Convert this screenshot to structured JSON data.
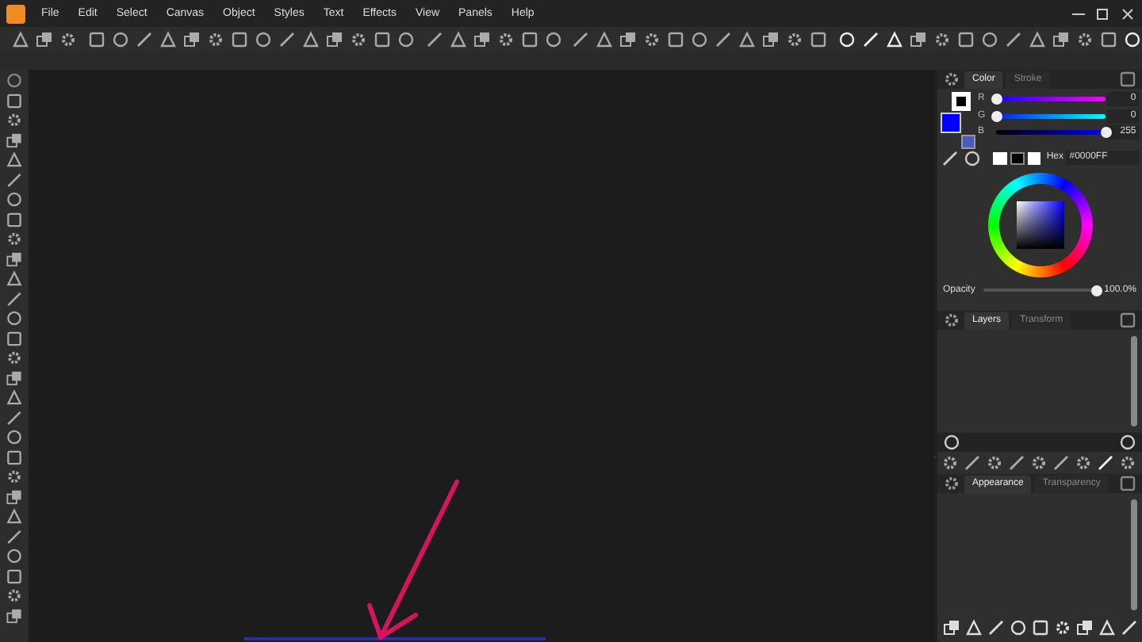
{
  "menu": [
    {
      "label": "File"
    },
    {
      "label": "Edit"
    },
    {
      "label": "Select"
    },
    {
      "label": "Canvas"
    },
    {
      "label": "Object"
    },
    {
      "label": "Styles"
    },
    {
      "label": "Text"
    },
    {
      "label": "Effects"
    },
    {
      "label": "View"
    },
    {
      "label": "Panels"
    },
    {
      "label": "Help"
    }
  ],
  "color_panel": {
    "tabs": [
      {
        "label": "Color",
        "selected": true
      },
      {
        "label": "Stroke",
        "selected": false
      }
    ],
    "channels": [
      {
        "name": "R",
        "level": 0,
        "reading": "0"
      },
      {
        "name": "G",
        "level": 0,
        "reading": "0"
      },
      {
        "name": "B",
        "level": 1,
        "reading": "255"
      }
    ],
    "hex_label": "Hex",
    "hex_value": "#0000FF",
    "opacity": {
      "label": "Opacity",
      "level": 1,
      "reading": "100.0%"
    }
  },
  "layers_panel": {
    "tabs": [
      {
        "label": "Layers",
        "selected": true
      },
      {
        "label": "Transform",
        "selected": false
      }
    ]
  },
  "appearance_panel": {
    "tabs": [
      {
        "label": "Appearance",
        "selected": true
      },
      {
        "label": "Transparency",
        "selected": false
      }
    ]
  }
}
